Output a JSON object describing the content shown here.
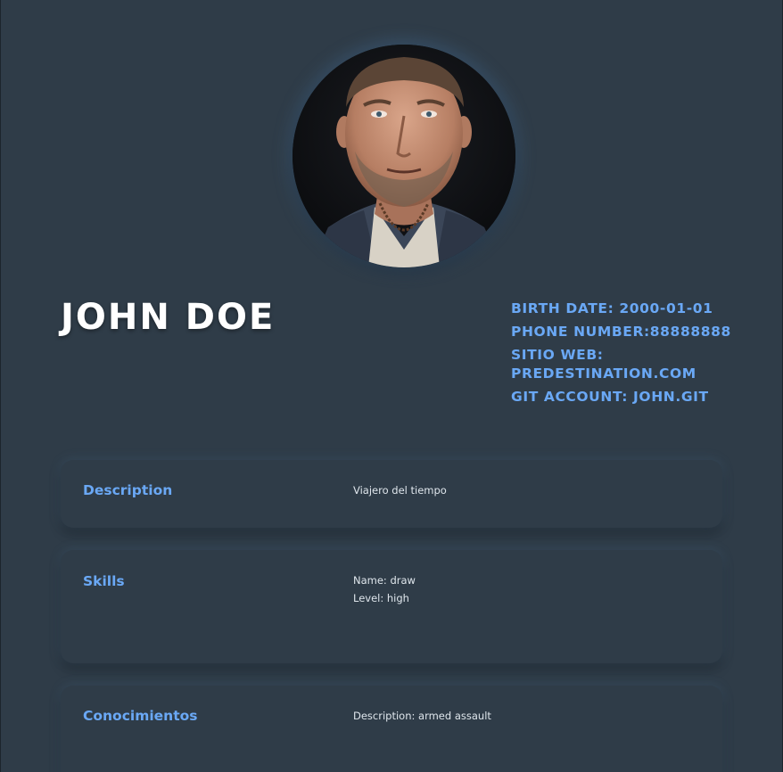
{
  "profile": {
    "name": "JOHN DOE",
    "photo_icon": "person-portrait"
  },
  "contact": {
    "birth_date": "BIRTH DATE: 2000-01-01",
    "phone": "PHONE NUMBER:88888888",
    "website": "SITIO WEB: PREDESTINATION.COM",
    "git": "GIT ACCOUNT: JOHN.GIT"
  },
  "sections": {
    "description": {
      "title": "Description",
      "text": "Viajero del tiempo"
    },
    "skills": {
      "title": "Skills",
      "name": "Name: draw",
      "level": "Level: high"
    },
    "knowledge": {
      "title": "Conocimientos",
      "description": "Description: armed assault"
    }
  },
  "colors": {
    "background": "#2f3c48",
    "accent": "#6aa8f5",
    "text": "#dfe6ec",
    "heading": "#ffffff"
  }
}
